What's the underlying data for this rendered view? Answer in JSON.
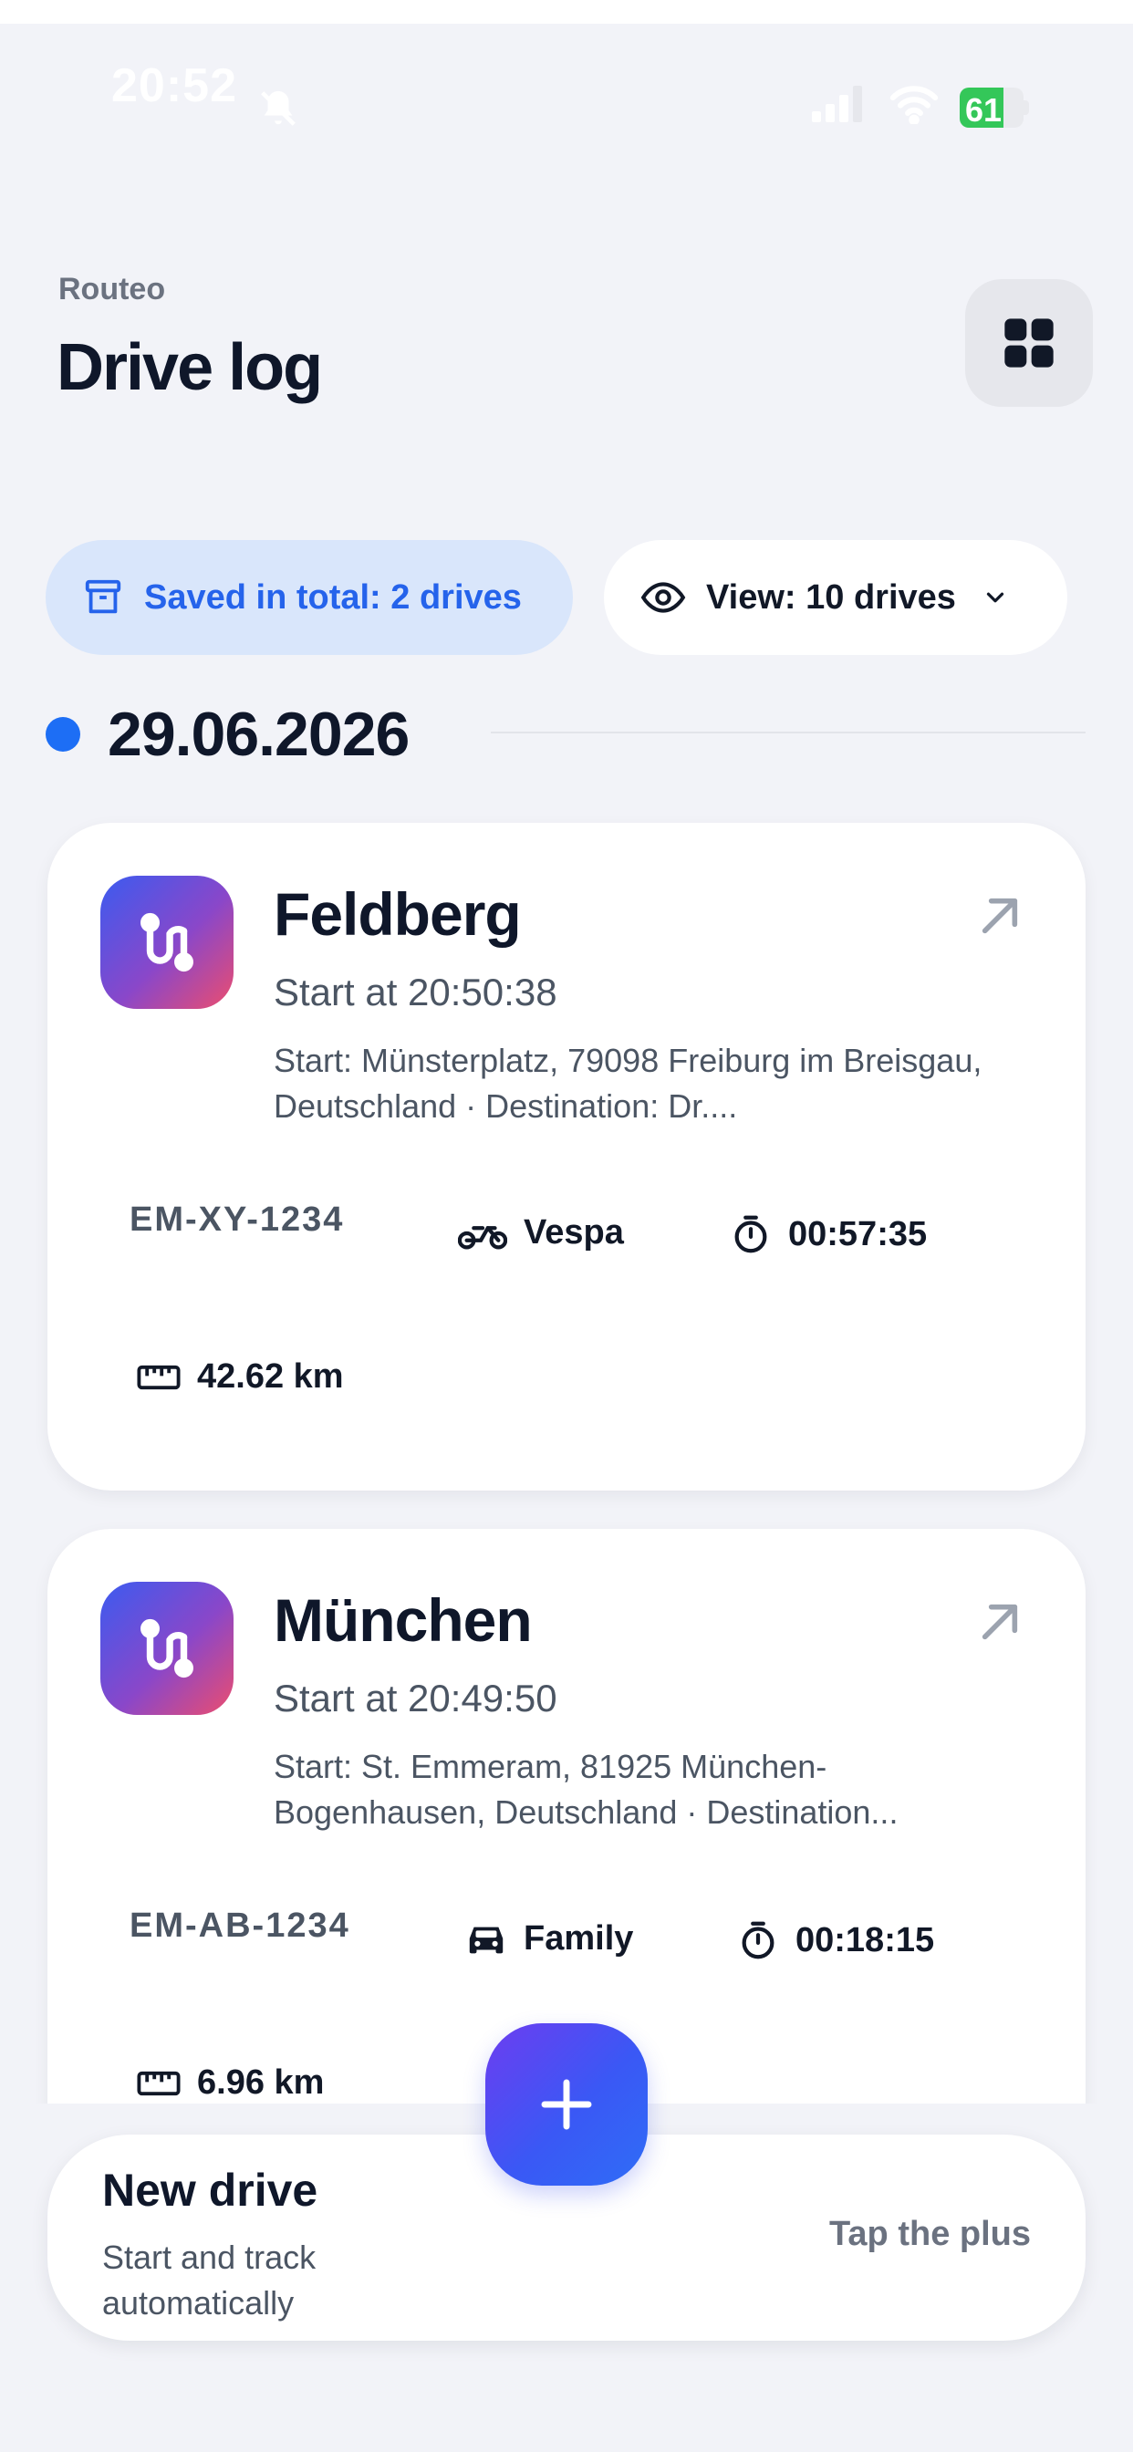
{
  "status_bar": {
    "time": "20:52",
    "battery": "61",
    "icons": [
      "bell-slash-icon",
      "cellular-signal-icon",
      "wifi-icon",
      "battery-icon"
    ]
  },
  "header": {
    "app_name": "Routeo",
    "title": "Drive log",
    "menu_icon": "grid-icon"
  },
  "chips": {
    "saved": {
      "label": "Saved in total: 2 drives",
      "icon": "archive-box-icon"
    },
    "view": {
      "label": "View: 10 drives",
      "icon": "eye-icon",
      "chevron": "chevron-down-icon"
    }
  },
  "date_group": {
    "date": "29.06.2026"
  },
  "drives": [
    {
      "title": "Feldberg",
      "start_time": "Start at 20:50:38",
      "address": "Start: Münsterplatz, 79098 Freiburg im Breisgau, Deutschland · Destination: Dr....",
      "plate": "EM-XY-1234",
      "vehicle": "Vespa",
      "vehicle_icon": "scooter-icon",
      "duration": "00:57:35",
      "distance": "42.62 km"
    },
    {
      "title": "München",
      "start_time": "Start at 20:49:50",
      "address": "Start: St. Emmeram, 81925 München-Bogenhausen, Deutschland · Destination...",
      "plate": "EM-AB-1234",
      "vehicle": "Family",
      "vehicle_icon": "car-icon",
      "duration": "00:18:15",
      "distance": "6.96 km"
    }
  ],
  "new_drive": {
    "title": "New drive",
    "subtitle": "Start and track automatically",
    "hint": "Tap the plus",
    "fab_icon": "plus-icon"
  },
  "colors": {
    "background": "#f2f3f8",
    "accent": "#2563eb",
    "saved_chip_bg": "#d9e6fb",
    "title": "#0f172a"
  }
}
